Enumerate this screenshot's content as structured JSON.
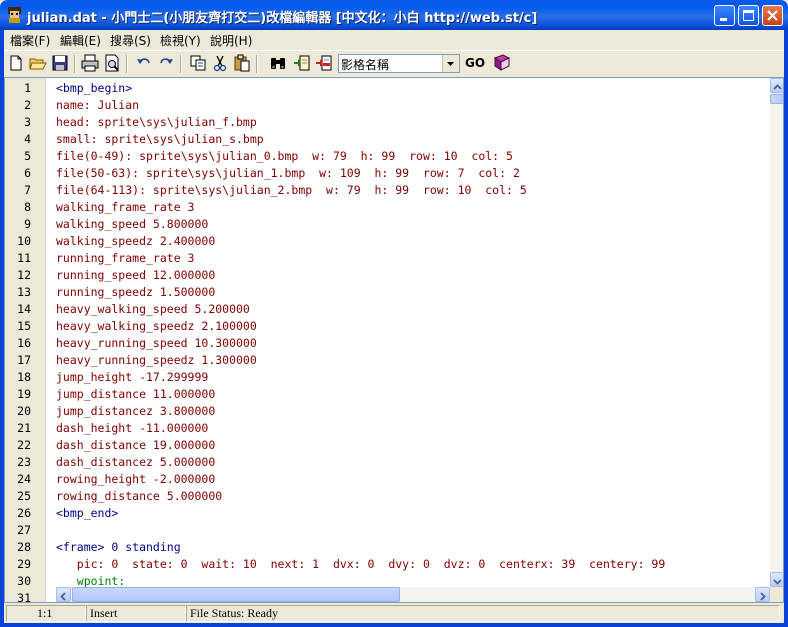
{
  "window": {
    "title": "julian.dat - 小門士二(小朋友齊打交二)改檔編輯器 [中文化：小白 http://web.st/c]"
  },
  "menu": [
    "檔案(F)",
    "編輯(E)",
    "搜尋(S)",
    "檢視(Y)",
    "說明(H)"
  ],
  "toolbar": {
    "icons": [
      "new-file-icon",
      "open-folder-icon",
      "save-disk-icon",
      "print-icon",
      "print-preview-icon",
      "undo-icon",
      "redo-icon",
      "copy-icon",
      "cut-icon",
      "paste-icon",
      "find-binoculars-icon",
      "find-next-icon",
      "find-prev-icon",
      "help-book-icon"
    ],
    "combo_value": "影格名稱",
    "go_label": "GO"
  },
  "editor": {
    "lines": [
      {
        "n": "1",
        "t": "<bmp_begin>",
        "k": "tag"
      },
      {
        "n": "2",
        "t": "name: Julian",
        "k": "key"
      },
      {
        "n": "3",
        "t": "head: sprite\\sys\\julian_f.bmp",
        "k": "key"
      },
      {
        "n": "4",
        "t": "small: sprite\\sys\\julian_s.bmp",
        "k": "key"
      },
      {
        "n": "5",
        "t": "file(0-49): sprite\\sys\\julian_0.bmp  w: 79  h: 99  row: 10  col: 5",
        "k": "key"
      },
      {
        "n": "6",
        "t": "file(50-63): sprite\\sys\\julian_1.bmp  w: 109  h: 99  row: 7  col: 2",
        "k": "key"
      },
      {
        "n": "7",
        "t": "file(64-113): sprite\\sys\\julian_2.bmp  w: 79  h: 99  row: 10  col: 5",
        "k": "key"
      },
      {
        "n": "8",
        "t": "walking_frame_rate 3",
        "k": "key"
      },
      {
        "n": "9",
        "t": "walking_speed 5.800000",
        "k": "key"
      },
      {
        "n": "10",
        "t": "walking_speedz 2.400000",
        "k": "key"
      },
      {
        "n": "11",
        "t": "running_frame_rate 3",
        "k": "key"
      },
      {
        "n": "12",
        "t": "running_speed 12.000000",
        "k": "key"
      },
      {
        "n": "13",
        "t": "running_speedz 1.500000",
        "k": "key"
      },
      {
        "n": "14",
        "t": "heavy_walking_speed 5.200000",
        "k": "key"
      },
      {
        "n": "15",
        "t": "heavy_walking_speedz 2.100000",
        "k": "key"
      },
      {
        "n": "16",
        "t": "heavy_running_speed 10.300000",
        "k": "key"
      },
      {
        "n": "17",
        "t": "heavy_running_speedz 1.300000",
        "k": "key"
      },
      {
        "n": "18",
        "t": "jump_height -17.299999",
        "k": "key"
      },
      {
        "n": "19",
        "t": "jump_distance 11.000000",
        "k": "key"
      },
      {
        "n": "20",
        "t": "jump_distancez 3.800000",
        "k": "key"
      },
      {
        "n": "21",
        "t": "dash_height -11.000000",
        "k": "key"
      },
      {
        "n": "22",
        "t": "dash_distance 19.000000",
        "k": "key"
      },
      {
        "n": "23",
        "t": "dash_distancez 5.000000",
        "k": "key"
      },
      {
        "n": "24",
        "t": "rowing_height -2.000000",
        "k": "key"
      },
      {
        "n": "25",
        "t": "rowing_distance 5.000000",
        "k": "key"
      },
      {
        "n": "26",
        "t": "<bmp_end>",
        "k": "tag"
      },
      {
        "n": "27",
        "t": "",
        "k": "key"
      },
      {
        "n": "28",
        "t": "<frame> 0 standing",
        "k": "tag"
      },
      {
        "n": "29",
        "t": "   pic: 0  state: 0  wait: 10  next: 1  dvx: 0  dvy: 0  dvz: 0  centerx: 39  centery: 99",
        "k": "key"
      },
      {
        "n": "30",
        "t": "   wpoint:",
        "k": "wp"
      },
      {
        "n": "31",
        "t": "",
        "k": "key"
      }
    ]
  },
  "status": {
    "position": "1:1",
    "mode": "Insert",
    "file_status": "File Status: Ready"
  }
}
